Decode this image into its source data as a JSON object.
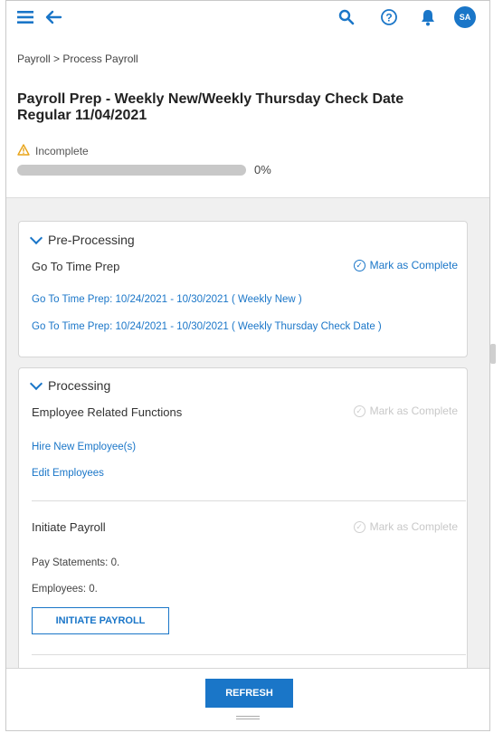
{
  "header": {
    "avatar_initials": "SA",
    "icons": [
      "hamburger-menu-icon",
      "back-arrow-icon",
      "search-icon",
      "help-icon",
      "bell-icon"
    ],
    "accent_color": "#1a76c8"
  },
  "breadcrumb": "Payroll > Process Payroll",
  "page_title": "Payroll Prep - Weekly New/Weekly Thursday Check Date Regular 11/04/2021",
  "status": {
    "label": "Incomplete",
    "progress_percent": 0,
    "progress_text": "0%"
  },
  "pre_processing": {
    "heading": "Pre-Processing",
    "section_title": "Go To Time Prep",
    "mark_label": "Mark as Complete",
    "links": [
      "Go To Time Prep: 10/24/2021 - 10/30/2021 ( Weekly New )",
      "Go To Time Prep: 10/24/2021 - 10/30/2021 ( Weekly Thursday Check Date )"
    ]
  },
  "processing": {
    "heading": "Processing",
    "employee_functions": {
      "title": "Employee Related Functions",
      "mark_label": "Mark as Complete",
      "links": [
        "Hire New Employee(s)",
        "Edit Employees"
      ]
    },
    "initiate_payroll": {
      "title": "Initiate Payroll",
      "mark_label": "Mark as Complete",
      "pay_statements": "Pay Statements: 0.",
      "employees": "Employees: 0.",
      "button_label": "INITIATE PAYROLL"
    }
  },
  "footer": {
    "refresh_label": "REFRESH"
  }
}
